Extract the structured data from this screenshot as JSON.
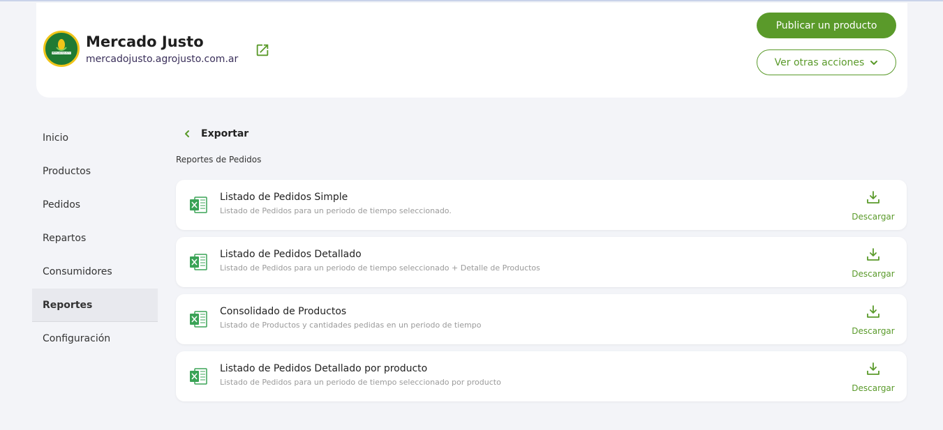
{
  "header": {
    "store_name": "Mercado Justo",
    "store_url": "mercadojusto.agrojusto.com.ar",
    "logo_text": "MERCADOJUSTO",
    "publish_label": "Publicar un producto",
    "more_actions_label": "Ver otras acciones"
  },
  "sidebar": {
    "items": [
      {
        "label": "Inicio"
      },
      {
        "label": "Productos"
      },
      {
        "label": "Pedidos"
      },
      {
        "label": "Repartos"
      },
      {
        "label": "Consumidores"
      },
      {
        "label": "Reportes",
        "active": true
      },
      {
        "label": "Configuración"
      }
    ]
  },
  "main": {
    "back_title": "Exportar",
    "section_title": "Reportes de Pedidos",
    "reports": [
      {
        "title": "Listado de Pedidos Simple",
        "description": "Listado de Pedidos para un periodo de tiempo seleccionado.",
        "action": "Descargar"
      },
      {
        "title": "Listado de Pedidos Detallado",
        "description": "Listado de Pedidos para un periodo de tiempo seleccionado + Detalle de Productos",
        "action": "Descargar"
      },
      {
        "title": "Consolidado de Productos",
        "description": "Listado de Productos y cantidades pedidas en un periodo de tiempo",
        "action": "Descargar"
      },
      {
        "title": "Listado de Pedidos Detallado por producto",
        "description": "Listado de Pedidos para un periodo de tiempo seleccionado por producto",
        "action": "Descargar"
      }
    ]
  },
  "colors": {
    "accent": "#5a9a2a",
    "background": "#f3f4f8",
    "excel_green": "#3aa356"
  },
  "icons": [
    "external-link-icon",
    "chevron-down-icon",
    "chevron-left-icon",
    "excel-file-icon",
    "download-icon"
  ]
}
